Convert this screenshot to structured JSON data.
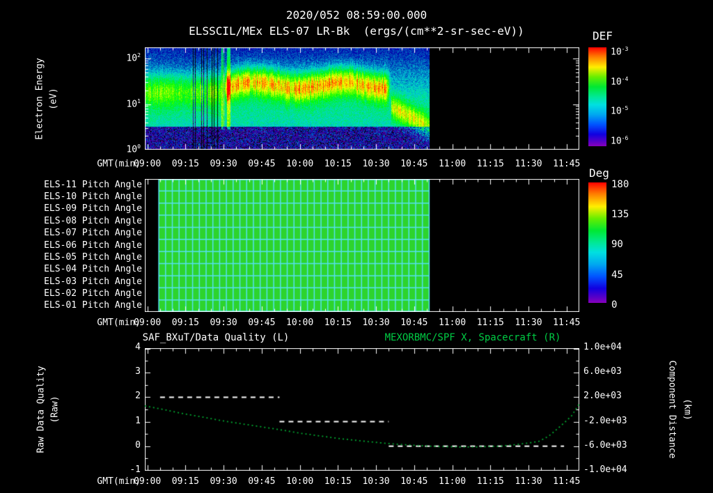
{
  "header": {
    "timestamp": "2020/052 08:59:00.000",
    "subtitle": "ELSSCIL/MEx ELS-07 LR-Bk  (ergs/(cm**2-sr-sec-eV))"
  },
  "colors": {
    "background": "#000000",
    "text": "#ffffff",
    "title_right_green": "#00cc44",
    "curve_green": "#00a830",
    "pitch_fill_green": "#2dd42d",
    "pitch_grid_cyan": "#55e0f0",
    "quality_dash_white": "#ffffff"
  },
  "time_axis": {
    "label": "GMT(min)",
    "start": "08:59",
    "span_minutes": 171,
    "first_tick_offset_min": 1,
    "tick_step_min": 15,
    "ticks": [
      "09:00",
      "09:15",
      "09:30",
      "09:45",
      "10:00",
      "10:15",
      "10:30",
      "10:45",
      "11:00",
      "11:15",
      "11:30",
      "11:45"
    ]
  },
  "chart_data": [
    {
      "type": "heatmap",
      "name": "electron-energy-spectrogram",
      "title": "ELSSCIL/MEx ELS-07 LR-Bk",
      "units": "ergs/(cm**2-sr-sec-eV)",
      "ylabel_line1": "Electron Energy",
      "ylabel_line2": "(eV)",
      "y_scale": "log",
      "y_range_ev": [
        1,
        175
      ],
      "y_tick_exponents": [
        2,
        1,
        0
      ],
      "colorbar": {
        "title": "DEF",
        "scale": "log",
        "tick_exponents": [
          -3,
          -4,
          -5,
          -6
        ],
        "range_log10": [
          -6,
          -3
        ]
      },
      "data_start_min": 0,
      "data_end_min": 112,
      "features": {
        "background_log10_flux": -5.45,
        "low_energy_dark_below_ev": 3.2,
        "main_band": {
          "start_min": 30,
          "end_min": 97,
          "center_ev": 27,
          "peak_log10_flux": -3.7
        },
        "pre_band": {
          "end_min": 30,
          "center_ev": 20,
          "peak_log10_flux": -4.4
        },
        "post_band": {
          "start_min": 97,
          "center_ev_start": 9,
          "center_ev_end": 3,
          "peak_log10_flux": -4.5
        },
        "dropout_window_min": [
          18,
          29
        ]
      }
    },
    {
      "type": "heatmap",
      "name": "pitch-angle-panel",
      "row_labels": [
        "ELS-11 Pitch Angle",
        "ELS-10 Pitch Angle",
        "ELS-09 Pitch Angle",
        "ELS-08 Pitch Angle",
        "ELS-07 Pitch Angle",
        "ELS-06 Pitch Angle",
        "ELS-05 Pitch Angle",
        "ELS-04 Pitch Angle",
        "ELS-03 Pitch Angle",
        "ELS-02 Pitch Angle",
        "ELS-01 Pitch Angle"
      ],
      "colorbar": {
        "title": "Deg",
        "ticks": [
          180,
          135,
          90,
          45,
          0
        ],
        "range_deg": [
          0,
          180
        ]
      },
      "data_start_min": 5.5,
      "data_end_min": 112,
      "cell_minutes": 2.66,
      "uniform_pitch_deg": 112,
      "grid_value_deg": 65
    },
    {
      "type": "line",
      "name": "quality-and-spacecraft-position",
      "title_left": "SAF_BXuT/Data Quality (L)",
      "title_right": "MEXORBMC/SPF X, Spacecraft (R)",
      "ylabel_left_line1": "Raw Data Quality",
      "ylabel_left_line2": "(Raw)",
      "ylabel_right_line1": "Component Distance",
      "ylabel_right_line2": "(km)",
      "ylim_left": [
        -1,
        4
      ],
      "left_ticks": [
        "4",
        "3",
        "2",
        "1",
        "0",
        "-1"
      ],
      "ylim_right": [
        -10000,
        10000
      ],
      "right_ticks": [
        "1.0e+04",
        "6.0e+03",
        "2.0e+03",
        "-2.0e+03",
        "-6.0e+03",
        "-1.0e+04"
      ],
      "series": [
        {
          "name": "SAF_BXuT Data Quality",
          "style": "dashed-white",
          "axis": "left",
          "segments": [
            {
              "start_min": 6,
              "end_min": 53,
              "value": 2
            },
            {
              "start_min": 53,
              "end_min": 96,
              "value": 1
            },
            {
              "start_min": 96,
              "end_min": 165,
              "value": 0
            }
          ]
        },
        {
          "name": "MEXORBMC/SPF X Spacecraft",
          "style": "dotted-green",
          "axis": "right",
          "minutes": [
            0,
            8,
            15,
            23,
            30,
            38,
            46,
            54,
            61,
            69,
            77,
            85,
            93,
            100,
            108,
            116,
            124,
            131,
            139,
            147,
            155,
            159,
            162,
            165,
            168,
            171
          ],
          "km": [
            568,
            -60,
            -680,
            -1260,
            -1818,
            -2340,
            -2841,
            -3360,
            -3864,
            -4330,
            -4773,
            -5130,
            -5454,
            -5700,
            -5909,
            -6060,
            -6136,
            -6110,
            -6023,
            -5700,
            -5227,
            -4350,
            -3295,
            -2200,
            -1023,
            909
          ]
        }
      ]
    }
  ]
}
